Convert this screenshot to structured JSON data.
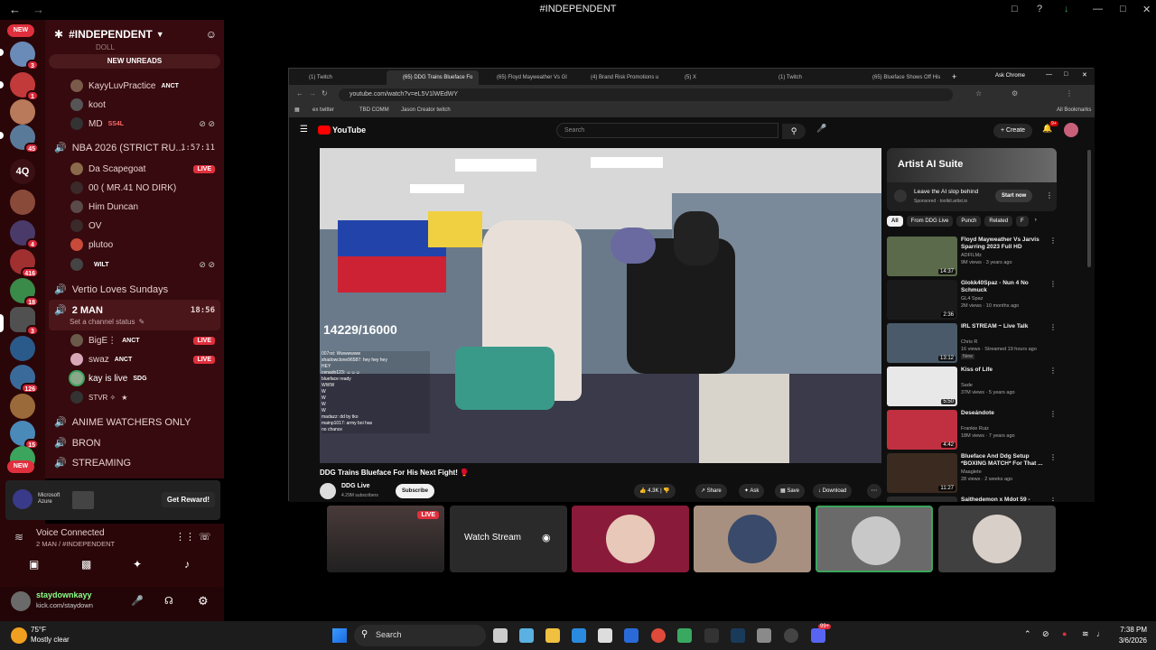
{
  "window": {
    "title": "#INDEPENDENT"
  },
  "colors": {
    "rail": "#2a0608",
    "sidebar": "#360a0e",
    "live": "#e0303d",
    "accent_green": "#3ba55d"
  },
  "servers": {
    "new_label": "NEW",
    "badges": [
      "3",
      "1",
      "45",
      "4Q",
      "4",
      "416",
      "18",
      "3",
      "126",
      "15"
    ],
    "bottom_new_label": "NEW"
  },
  "sidebar": {
    "server_name": "#INDEPENDENT",
    "new_unreads": "NEW UNREADS",
    "cut_top_text": "DOLL",
    "voice_channel_1": {
      "users": [
        {
          "name": "KayyLuvPractice",
          "tag": "ANCT"
        },
        {
          "name": "koot"
        },
        {
          "name": "MD",
          "tag": "SS4L"
        }
      ]
    },
    "channel_nba": {
      "name": "NBA 2026 (STRICT RU...",
      "time": "1:57:11"
    },
    "nba_users": [
      {
        "name": "Da Scapegoat",
        "live": "LIVE"
      },
      {
        "name": "00 ( MR.41 NO DIRK)"
      },
      {
        "name": "Him Duncan"
      },
      {
        "name": "OV"
      },
      {
        "name": "plutoo"
      },
      {
        "name": "",
        "tag": "WILT"
      }
    ],
    "channel_vertio": "Vertio Loves Sundays",
    "channel_2man": {
      "name": "2 MAN",
      "time": "18:56",
      "status": "Set a channel status"
    },
    "twoman_users": [
      {
        "name": "BigE⋮",
        "tag": "ANCT",
        "live": "LIVE"
      },
      {
        "name": "swaz",
        "tag": "ANCT",
        "live": "LIVE"
      },
      {
        "name": "kay is live",
        "tag": "SDG"
      },
      {
        "name": "STVR ✧"
      }
    ],
    "channel_anime": "ANIME WATCHERS ONLY",
    "channel_bron": "BRON",
    "channel_streaming": "STREAMING"
  },
  "promo": {
    "brand": "Microsoft Azure",
    "button": "Get Reward!"
  },
  "voice": {
    "status": "Voice Connected",
    "channel": "2 MAN / #INDEPENDENT"
  },
  "user": {
    "name": "staydownkayy",
    "status": "kick.com/staydown"
  },
  "browser": {
    "tabs": [
      "(1) Twitch",
      "(65) DDG Trains Blueface Fo",
      "(65) Floyd Mayweather Vs Gl",
      "(4) Brand Risk Promotions u",
      "(5) X",
      "(1) Twitch",
      "(65) Blueface Shows Off His"
    ],
    "ask": "Ask Chrome",
    "url": "youtube.com/watch?v=eL5V1lWEdWY",
    "bookmarks": [
      "ex twitter",
      "TBD COMM",
      "Jason Creator twitch"
    ],
    "all_bookmarks": "All Bookmarks"
  },
  "youtube": {
    "logo": "YouTube",
    "search_placeholder": "Search",
    "create": "Create",
    "notif_count": "9+",
    "overlay_count": "14229/16000",
    "chat_lines": [
      "007rst: Wwwwwww",
      "shadowclone96587: hey hey hey",
      "HEY",
      "cenado123: ☺☺☺",
      "blueface ready",
      "WWW",
      "W",
      "W",
      "W",
      "W",
      "madazz: dd by tko",
      "mainp1017: army boi has",
      "no chance"
    ],
    "video_title": "DDG Trains Blueface For His Next Fight! 🥊",
    "channel": "DDG Live",
    "subscribers": "4.29M subscribers",
    "subscribe": "Subscribe",
    "likes": "4.3K",
    "share": "Share",
    "ask": "Ask",
    "save": "Save",
    "download": "Download",
    "ad": {
      "title": "Artist AI Suite",
      "tagline": "Leave the AI slop behind",
      "sponsored": "Sponsored",
      "domain": "toolkit.artist.io",
      "cta": "Start now"
    },
    "chips": [
      "All",
      "From DDG Live",
      "Punch",
      "Related",
      "F"
    ],
    "related": [
      {
        "title": "Floyd Mayweather Vs Jarvis Sparring 2023 Full HD",
        "channel": "ADFILMz",
        "meta": "9M views · 3 years ago",
        "duration": "14:37",
        "color": "#5a6a4a"
      },
      {
        "title": "Glokk40Spaz - Nun 4 No Schmuck",
        "channel": "GL4 Spaz",
        "meta": "2M views · 10 months ago",
        "duration": "2:36",
        "color": "#1a1a1a"
      },
      {
        "title": "IRL STREAM ~ Live Talk",
        "channel": "Chris R",
        "meta": "16 views · Streamed 19 hours ago",
        "badge": "New",
        "duration": "13:12",
        "color": "#4a5a6a"
      },
      {
        "title": "Kiss of Life",
        "channel": "Sade",
        "meta": "37M views · 5 years ago",
        "duration": "5:50",
        "color": "#e8e8e8"
      },
      {
        "title": "Deseándote",
        "channel": "Frankie Ruiz",
        "meta": "18M views · 7 years ago",
        "duration": "4:42",
        "color": "#c03040"
      },
      {
        "title": "Blueface And Ddg Setup *BOXING MATCH* For That ...",
        "channel": "Maaglete",
        "meta": "28 views · 2 weeks ago",
        "duration": "11:27",
        "color": "#3a2a20"
      },
      {
        "title": "Saithedemon x Mdot 59 -",
        "channel": "",
        "meta": "",
        "duration": "",
        "color": "#2a2a2a"
      }
    ]
  },
  "streams": {
    "live": "LIVE",
    "watch": "Watch Stream"
  },
  "taskbar": {
    "weather_temp": "75°F",
    "weather_desc": "Mostly clear",
    "search": "Search",
    "time": "7:38 PM",
    "date": "3/6/2026",
    "discord_badge": "99+"
  }
}
